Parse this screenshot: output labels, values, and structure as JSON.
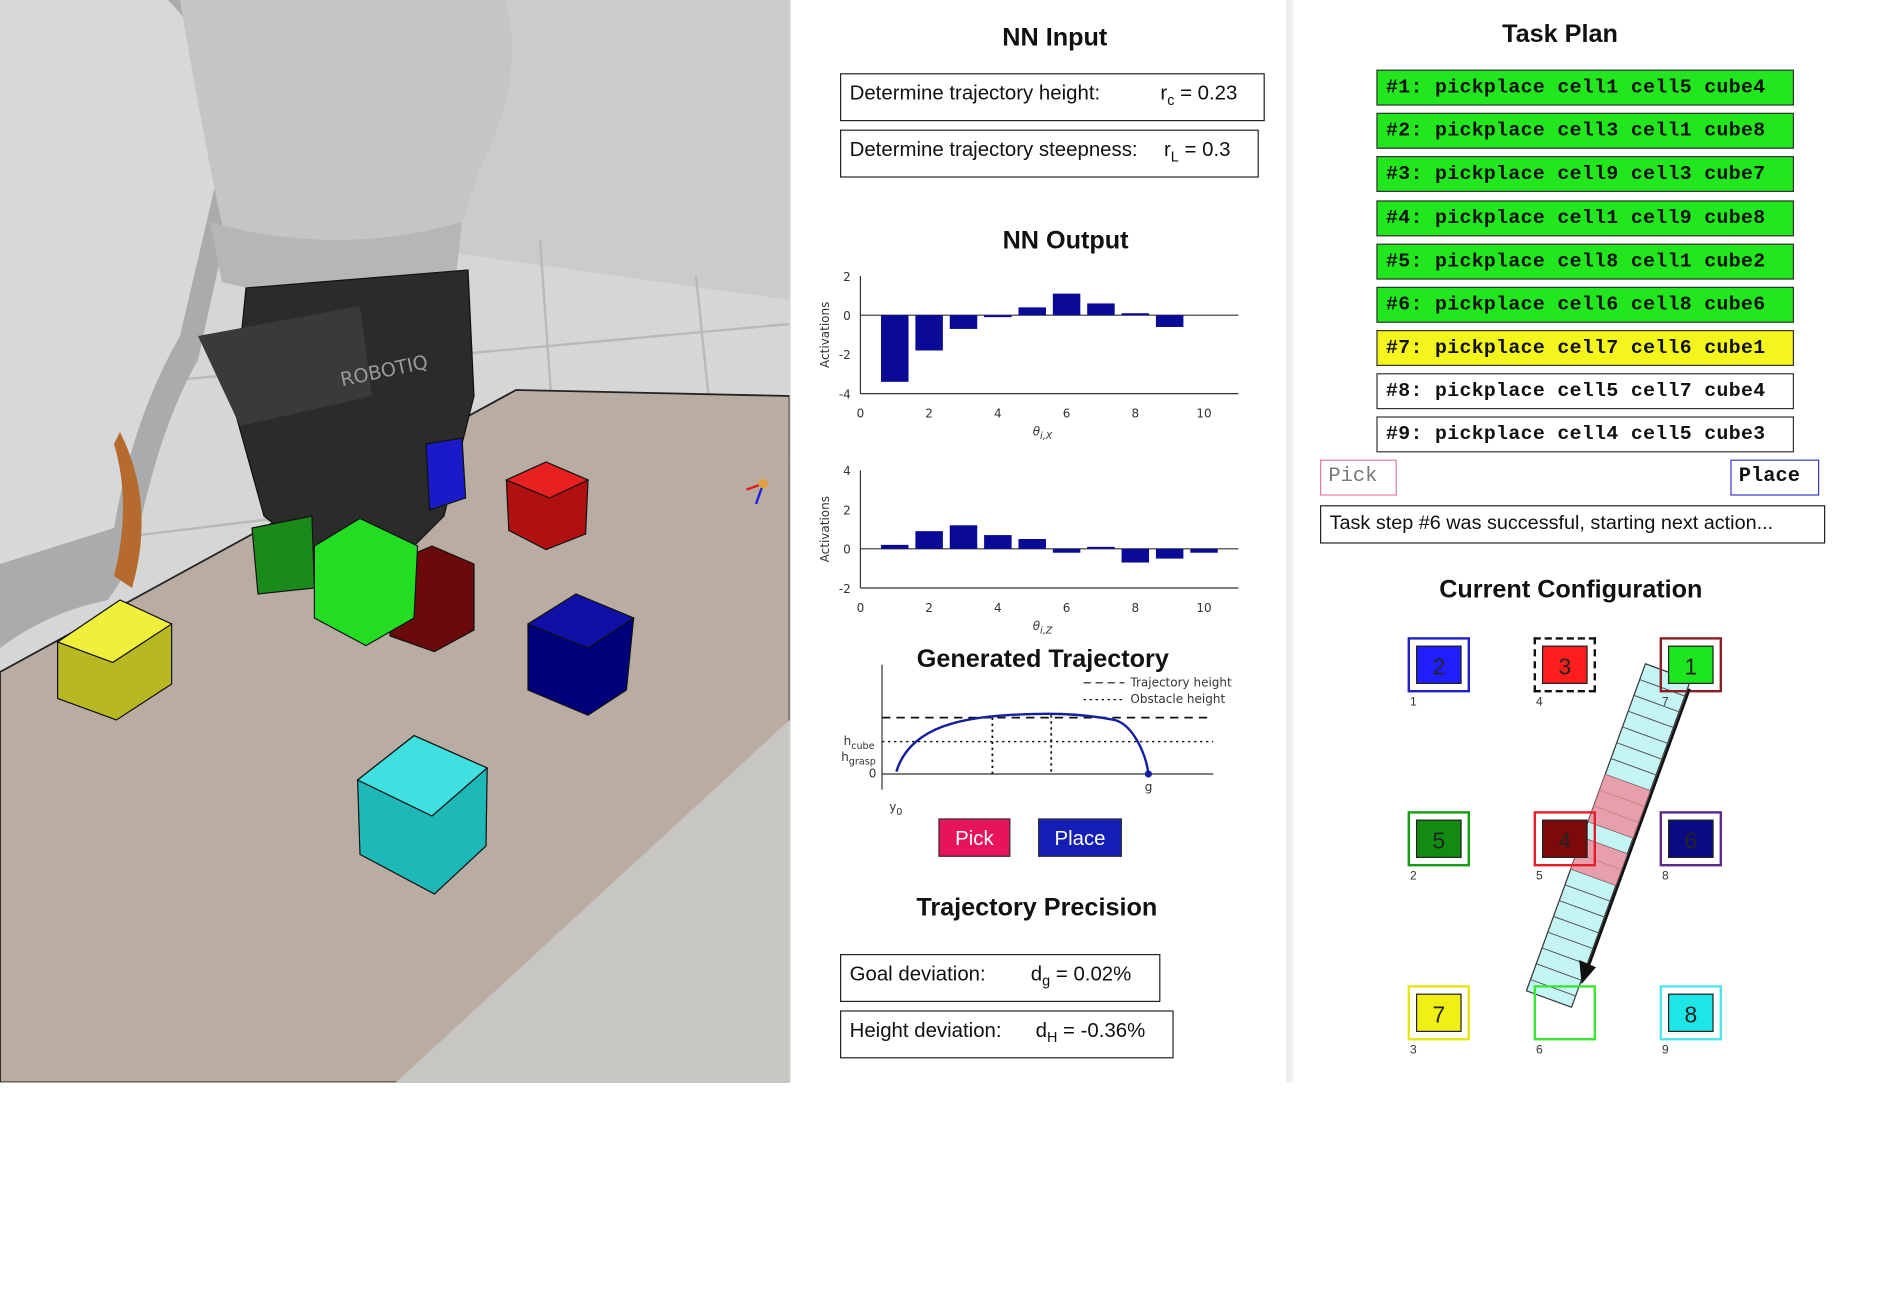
{
  "nn_input": {
    "title": "NN Input",
    "height_label": "Determine trajectory height:",
    "height_param": "r",
    "height_sub": "c",
    "height_value": "= 0.23",
    "steep_label": "Determine trajectory steepness:",
    "steep_param": "r",
    "steep_sub": "L",
    "steep_value": "= 0.3"
  },
  "nn_output": {
    "title": "NN Output",
    "ylabel": "Activations",
    "x_ticks": [
      "0",
      "2",
      "4",
      "6",
      "8",
      "10"
    ],
    "plot1": {
      "xlabel": "θ",
      "xlabel_sub": "i,X",
      "y_ticks": [
        "2",
        "0",
        "-2",
        "-4"
      ],
      "ylim": [
        -4,
        2
      ],
      "values": [
        -3.4,
        -1.8,
        -0.7,
        -0.1,
        0.4,
        1.1,
        0.6,
        0.1,
        -0.6
      ]
    },
    "plot2": {
      "xlabel": "θ",
      "xlabel_sub": "i,Z",
      "y_ticks": [
        "4",
        "2",
        "0",
        "-2"
      ],
      "ylim": [
        -2,
        4
      ],
      "values": [
        0.2,
        0.9,
        1.2,
        0.7,
        0.5,
        -0.2,
        0.1,
        -0.7,
        -0.5,
        -0.2
      ]
    },
    "bar_color": "#0a0a96"
  },
  "trajectory": {
    "title": "Generated Trajectory",
    "legend_height": "Trajectory height",
    "legend_obstacle": "Obstacle height",
    "h_cube": "h",
    "h_cube_sub": "cube",
    "h_grasp": "h",
    "h_grasp_sub": "grasp",
    "zero": "0",
    "y0": "y",
    "y0_sub": "0",
    "end_label": "g",
    "pick_label": "Pick",
    "place_label": "Place",
    "pick_color": "#e8145a",
    "place_color": "#141eb4"
  },
  "precision": {
    "title": "Trajectory Precision",
    "goal_label": "Goal deviation:",
    "goal_param": "d",
    "goal_sub": "g",
    "goal_value": "= 0.02%",
    "height_label": "Height deviation:",
    "height_param": "d",
    "height_sub": "H",
    "height_value": "= -0.36%"
  },
  "task_plan": {
    "title": "Task Plan",
    "tasks": [
      {
        "text": "#1: pickplace cell1 cell5 cube4",
        "status": "done"
      },
      {
        "text": "#2: pickplace cell3 cell1 cube8",
        "status": "done"
      },
      {
        "text": "#3: pickplace cell9 cell3 cube7",
        "status": "done"
      },
      {
        "text": "#4: pickplace cell1 cell9 cube8",
        "status": "done"
      },
      {
        "text": "#5: pickplace cell8 cell1 cube2",
        "status": "done"
      },
      {
        "text": "#6: pickplace cell6 cell8 cube6",
        "status": "done"
      },
      {
        "text": "#7: pickplace cell7 cell6 cube1",
        "status": "active"
      },
      {
        "text": "#8: pickplace cell5 cell7 cube4",
        "status": "pending"
      },
      {
        "text": "#9: pickplace cell4 cell5 cube3",
        "status": "pending"
      }
    ],
    "status_colors": {
      "done": "#22e61e",
      "active": "#f5f51e",
      "pending": "#ffffff"
    },
    "pick_tag": "Pick",
    "place_tag": "Place",
    "status_message": "Task step #6 was successful, starting next action..."
  },
  "configuration": {
    "title": "Current Configuration",
    "cells": [
      {
        "cell": "1",
        "cube": "2",
        "fill": "#1e1eff",
        "border": "#2020c8"
      },
      {
        "cell": "4",
        "cube": "3",
        "fill": "#ff1e1e",
        "border": "#111111"
      },
      {
        "cell": "7",
        "cube": "1",
        "fill": "#1ee61e",
        "border": "#8c1e2a"
      },
      {
        "cell": "2",
        "cube": "5",
        "fill": "#118c11",
        "border": "#14a014"
      },
      {
        "cell": "5",
        "cube": "4",
        "fill": "#7d0a0a",
        "border": "#e61e2a"
      },
      {
        "cell": "8",
        "cube": "6",
        "fill": "#0a0a82",
        "border": "#5a2a8c"
      },
      {
        "cell": "3",
        "cube": "7",
        "fill": "#f0f014",
        "border": "#e6e614"
      },
      {
        "cell": "6",
        "cube": "",
        "fill": "#ffffff",
        "border": "#3ce632"
      },
      {
        "cell": "9",
        "cube": "8",
        "fill": "#1ee6e6",
        "border": "#50e6f0"
      }
    ]
  }
}
